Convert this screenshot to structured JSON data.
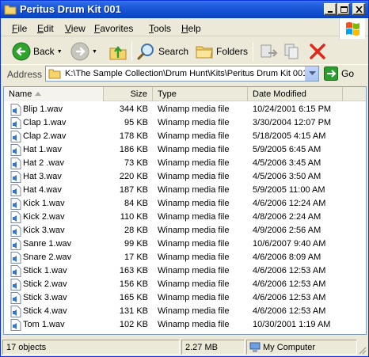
{
  "window": {
    "title": "Peritus Drum Kit 001",
    "controls": {
      "minimize": "minimize",
      "maximize": "maximize",
      "close": "close"
    }
  },
  "menu": [
    "File",
    "Edit",
    "View",
    "Favorites",
    "Tools",
    "Help"
  ],
  "toolbar": {
    "back_label": "Back",
    "search_label": "Search",
    "folders_label": "Folders"
  },
  "address": {
    "label": "Address",
    "path": "K:\\The Sample Collection\\Drum Hunt\\Kits\\Peritus Drum Kit 001",
    "go_label": "Go"
  },
  "columns": {
    "name": "Name",
    "size": "Size",
    "type": "Type",
    "date": "Date Modified"
  },
  "files": [
    {
      "name": "Blip 1.wav",
      "size": "344 KB",
      "type": "Winamp media file",
      "date": "10/24/2001 6:15 PM"
    },
    {
      "name": "Clap 1.wav",
      "size": "95 KB",
      "type": "Winamp media file",
      "date": "3/30/2004 12:07 PM"
    },
    {
      "name": "Clap 2.wav",
      "size": "178 KB",
      "type": "Winamp media file",
      "date": "5/18/2005 4:15 AM"
    },
    {
      "name": "Hat 1.wav",
      "size": "186 KB",
      "type": "Winamp media file",
      "date": "5/9/2005 6:45 AM"
    },
    {
      "name": "Hat 2 .wav",
      "size": "73 KB",
      "type": "Winamp media file",
      "date": "4/5/2006 3:45 AM"
    },
    {
      "name": "Hat 3.wav",
      "size": "220 KB",
      "type": "Winamp media file",
      "date": "4/5/2006 3:50 AM"
    },
    {
      "name": "Hat 4.wav",
      "size": "187 KB",
      "type": "Winamp media file",
      "date": "5/9/2005 11:00 AM"
    },
    {
      "name": "Kick 1.wav",
      "size": "84 KB",
      "type": "Winamp media file",
      "date": "4/6/2006 12:24 AM"
    },
    {
      "name": "Kick 2.wav",
      "size": "110 KB",
      "type": "Winamp media file",
      "date": "4/8/2006 2:24 AM"
    },
    {
      "name": "Kick 3.wav",
      "size": "28 KB",
      "type": "Winamp media file",
      "date": "4/9/2006 2:56 AM"
    },
    {
      "name": "Sanre 1.wav",
      "size": "99 KB",
      "type": "Winamp media file",
      "date": "10/6/2007 9:40 AM"
    },
    {
      "name": "Snare 2.wav",
      "size": "17 KB",
      "type": "Winamp media file",
      "date": "4/6/2006 8:09 AM"
    },
    {
      "name": "Stick 1.wav",
      "size": "163 KB",
      "type": "Winamp media file",
      "date": "4/6/2006 12:53 AM"
    },
    {
      "name": "Stick 2.wav",
      "size": "156 KB",
      "type": "Winamp media file",
      "date": "4/6/2006 12:53 AM"
    },
    {
      "name": "Stick 3.wav",
      "size": "165 KB",
      "type": "Winamp media file",
      "date": "4/6/2006 12:53 AM"
    },
    {
      "name": "Stick 4.wav",
      "size": "131 KB",
      "type": "Winamp media file",
      "date": "4/6/2006 12:53 AM"
    },
    {
      "name": "Tom 1.wav",
      "size": "102 KB",
      "type": "Winamp media file",
      "date": "10/30/2001 1:19 AM"
    }
  ],
  "status": {
    "objects": "17 objects",
    "total_size": "2.27 MB",
    "location": "My Computer"
  },
  "icons": {
    "folder": "folder-icon",
    "back": "back-arrow-icon",
    "forward": "forward-arrow-icon",
    "up": "folder-up-icon",
    "search": "search-icon",
    "folders": "folders-icon",
    "move_to": "move-to-icon",
    "copy_to": "copy-to-icon",
    "delete": "delete-x-icon",
    "go": "go-arrow-icon",
    "file": "winamp-audio-file-icon",
    "computer": "my-computer-icon"
  },
  "colors": {
    "titlebar": "#0d49c8",
    "back_button": "#2ea32e",
    "delete": "#e0271c",
    "go": "#2e9c2e"
  }
}
